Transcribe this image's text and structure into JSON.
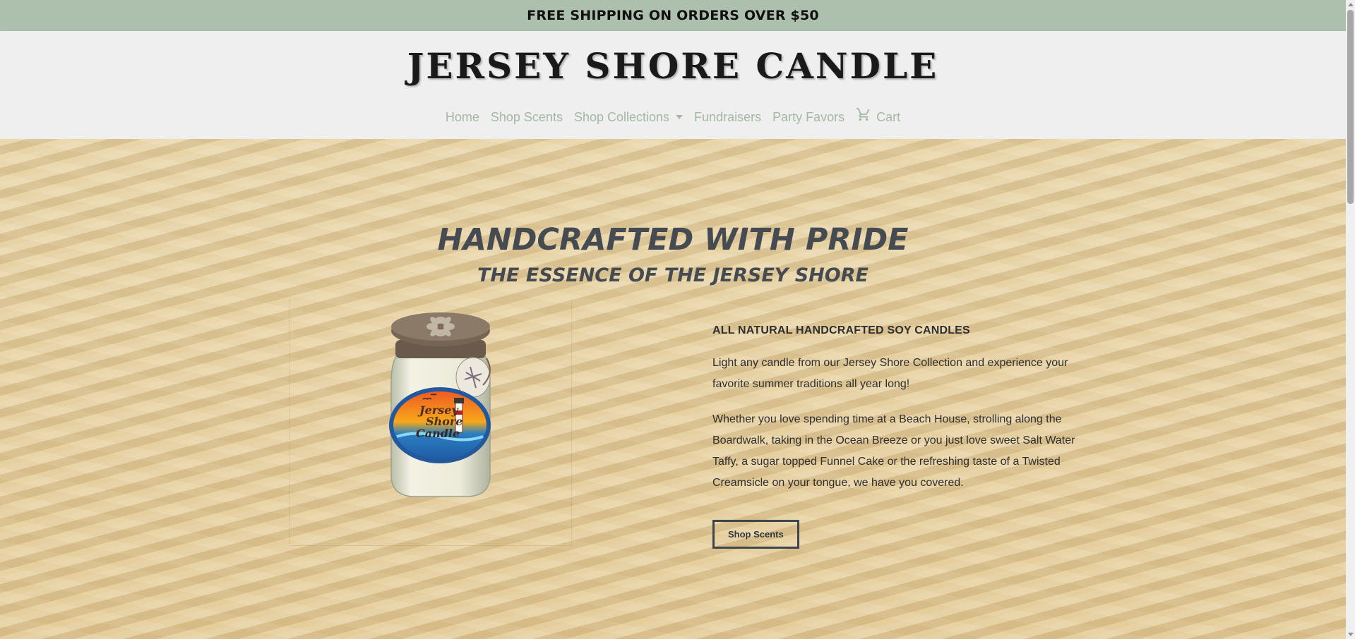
{
  "promo": {
    "text": "FREE SHIPPING ON ORDERS OVER $50"
  },
  "header": {
    "logo": "JERSEY SHORE CANDLE",
    "nav": {
      "home": "Home",
      "shop_scents": "Shop Scents",
      "shop_collections": "Shop Collections",
      "fundraisers": "Fundraisers",
      "party_favors": "Party Favors",
      "cart": "Cart"
    }
  },
  "hero": {
    "title": "HANDCRAFTED WITH PRIDE",
    "subtitle": "THE ESSENCE OF THE JERSEY SHORE",
    "product_label": [
      "Jersey",
      "Shore",
      "Candle"
    ],
    "copy": {
      "heading": "ALL NATURAL HANDCRAFTED SOY CANDLES",
      "paragraph_1": "Light any candle from our Jersey Shore Collection and experience your favorite summer traditions all year long!",
      "paragraph_2": "Whether you love spending time at a Beach House, strolling along the Boardwalk, taking in the Ocean Breeze or you just love sweet Salt Water Taffy, a sugar topped Funnel Cake or the refreshing taste of a Twisted Creamsicle on your tongue, we have you covered.",
      "button": "Shop Scents"
    }
  },
  "colors": {
    "promo_bg": "#adbfad",
    "nav_text": "#a5b7a5",
    "heading_text": "#454b51",
    "sand": "#e8d4a6"
  },
  "icons": {
    "cart": "cart-icon",
    "dropdown": "chevron-down-icon"
  }
}
